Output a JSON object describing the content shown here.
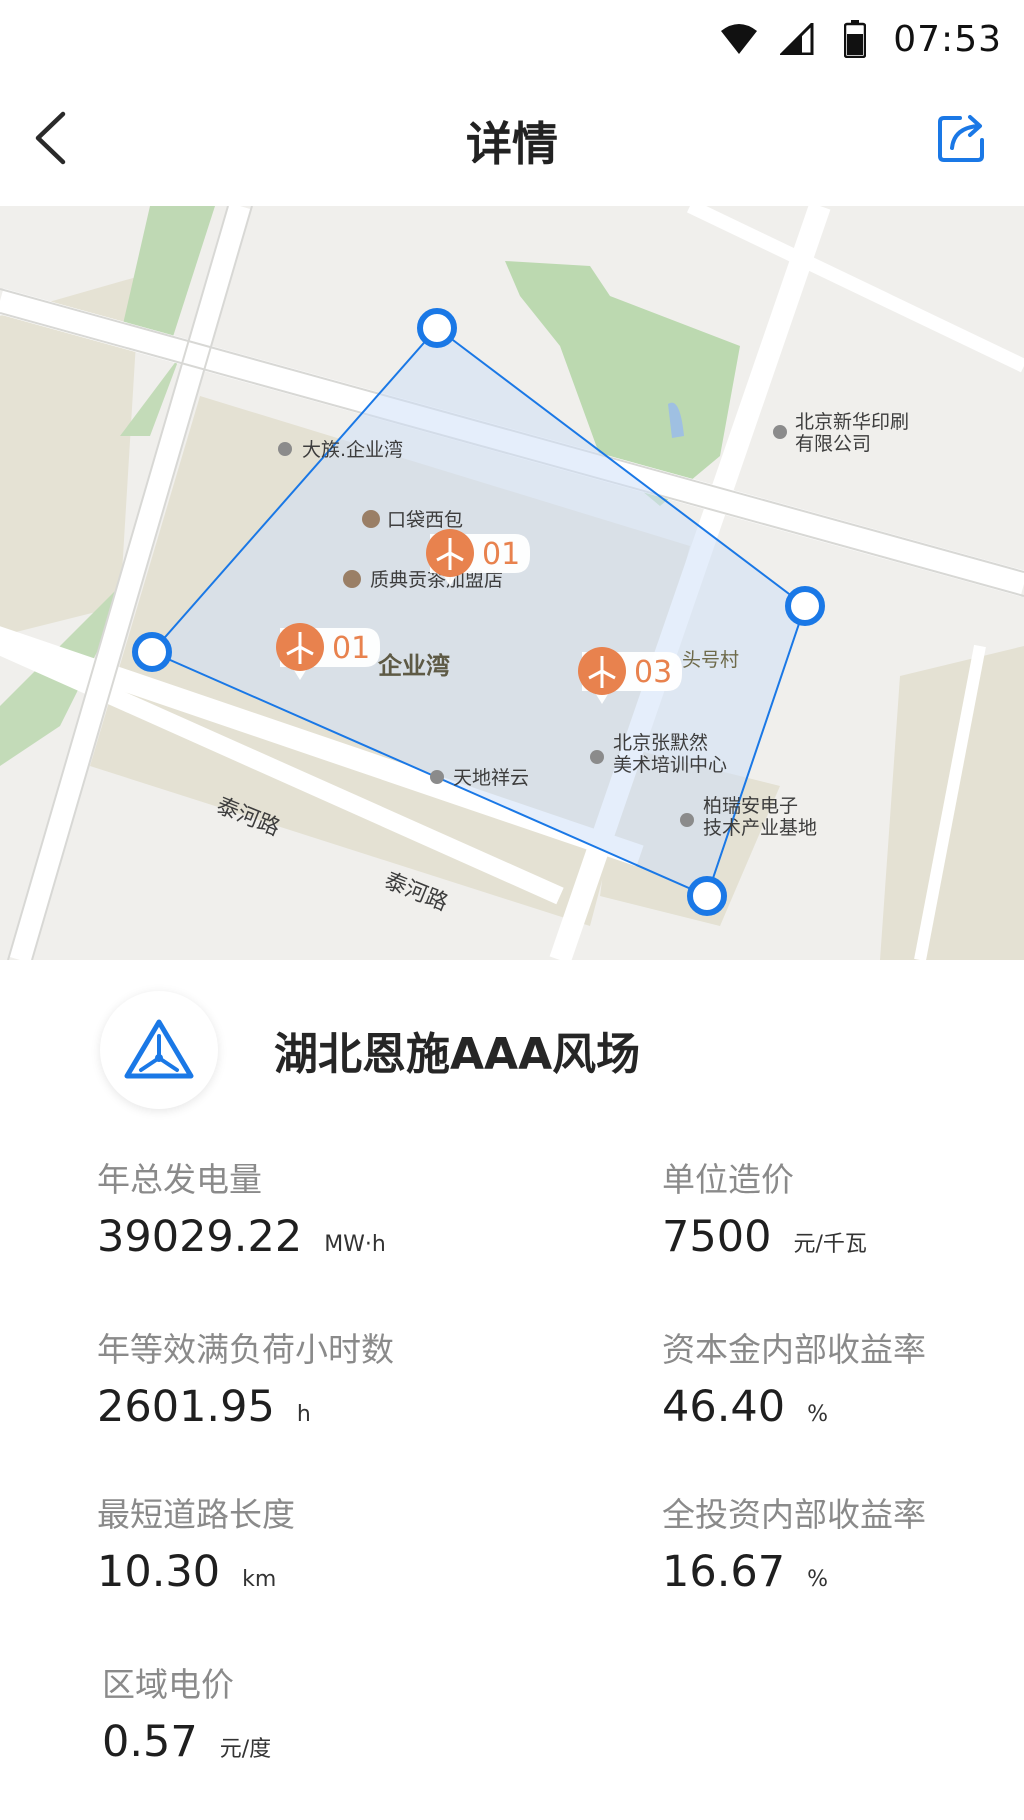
{
  "status_bar": {
    "time": "07:53",
    "icons": [
      "wifi-icon",
      "signal-icon",
      "battery-icon"
    ]
  },
  "header": {
    "title": "详情",
    "back_icon": "chevron-left-icon",
    "share_icon": "share-icon"
  },
  "map": {
    "pois": [
      "大族.企业湾",
      "口袋西包",
      "质典贡茶加盟店",
      "北京新华印刷",
      "有限公司",
      "天地祥云",
      "北京张默然",
      "美术培训中心",
      "柏瑞安电子",
      "技术产业基地"
    ],
    "area_labels": [
      "企业湾",
      "头号村"
    ],
    "roads": [
      "泰河路",
      "泰河路"
    ],
    "markers": [
      "01",
      "01",
      "03"
    ]
  },
  "farm": {
    "name": "湖北恩施AAA风场",
    "logo_icon": "wind-turbine-logo-icon"
  },
  "stats": [
    {
      "label": "年总发电量",
      "value": "39029.22",
      "unit": "MW·h"
    },
    {
      "label": "单位造价",
      "value": "7500",
      "unit": "元/千瓦"
    },
    {
      "label": "年等效满负荷小时数",
      "value": "2601.95",
      "unit": "h"
    },
    {
      "label": "资本金内部收益率",
      "value": "46.40",
      "unit": "%"
    },
    {
      "label": "最短道路长度",
      "value": "10.30",
      "unit": "km"
    },
    {
      "label": "全投资内部收益率",
      "value": "16.67",
      "unit": "%"
    },
    {
      "label": "区域电价",
      "value": "0.57",
      "unit": "元/度"
    }
  ],
  "colors": {
    "accent": "#1a78e6",
    "marker": "#e8824e",
    "polygon_fill": "#cfe0f7"
  }
}
